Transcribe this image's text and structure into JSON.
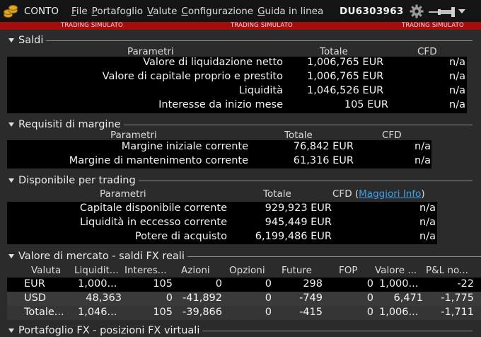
{
  "titlebar": {
    "app_title": "CONTO",
    "menu": [
      {
        "u": "F",
        "rest": "ile"
      },
      {
        "u": "P",
        "rest": "ortafoglio"
      },
      {
        "u": "V",
        "rest": "alute"
      },
      {
        "u": "C",
        "rest": "onfigurazione"
      },
      {
        "u": "G",
        "rest": "uida in linea"
      }
    ],
    "account_id": "DU6303963"
  },
  "simbar": {
    "label": "TRADING SIMULATO"
  },
  "saldi": {
    "title": "Saldi",
    "headers": {
      "param": "Parametri",
      "total": "Totale",
      "cfd": "CFD"
    },
    "rows": [
      {
        "label": "Valore di liquidazione netto",
        "total": "1,006,765 EUR",
        "cfd": "n/a"
      },
      {
        "label": "Valore di capitale proprio e prestito",
        "total": "1,006,765 EUR",
        "cfd": "n/a"
      },
      {
        "label": "Liquidità",
        "total": "1,046,526 EUR",
        "cfd": "n/a"
      },
      {
        "label": "Interesse da inizio mese",
        "total": "105 EUR",
        "cfd": "n/a"
      }
    ]
  },
  "margine": {
    "title": "Requisiti di margine",
    "headers": {
      "param": "Parametri",
      "total": "Totale",
      "cfd": "CFD"
    },
    "rows": [
      {
        "label": "Margine iniziale corrente",
        "total": "76,842 EUR",
        "cfd": "n/a"
      },
      {
        "label": "Margine di mantenimento corrente",
        "total": "61,316 EUR",
        "cfd": "n/a"
      }
    ]
  },
  "disponibile": {
    "title": "Disponibile per trading",
    "headers": {
      "param": "Parametri",
      "total": "Totale",
      "cfd": "CFD (",
      "link": "Maggiori Info",
      "close": ")"
    },
    "rows": [
      {
        "label": "Capitale disponibile corrente",
        "total": "929,923 EUR",
        "cfd": "n/a"
      },
      {
        "label": "Liquidità in eccesso corrente",
        "total": "945,449 EUR",
        "cfd": "n/a"
      },
      {
        "label": "Potere di acquisto",
        "total": "6,199,486 EUR",
        "cfd": "n/a"
      }
    ]
  },
  "mercato": {
    "title": "Valore di mercato - saldi FX reali",
    "headers": [
      "Valuta",
      "Liquidit...",
      "Interes...",
      "Azioni",
      "Opzioni",
      "Future",
      "FOP",
      "Valore ...",
      "P&L no..."
    ],
    "rows": [
      [
        "EUR",
        "1,000...",
        "105",
        "0",
        "0",
        "298",
        "0",
        "1,000...",
        "-22"
      ],
      [
        "USD",
        "48,363",
        "0",
        "-41,892",
        "0",
        "-749",
        "0",
        "6,471",
        "-1,775"
      ],
      [
        "Totale...",
        "1,046...",
        "105",
        "-39,866",
        "0",
        "-415",
        "0",
        "1,006...",
        "-1,711"
      ]
    ]
  },
  "fx": {
    "title": "Portafoglio FX - posizioni FX virtuali"
  }
}
